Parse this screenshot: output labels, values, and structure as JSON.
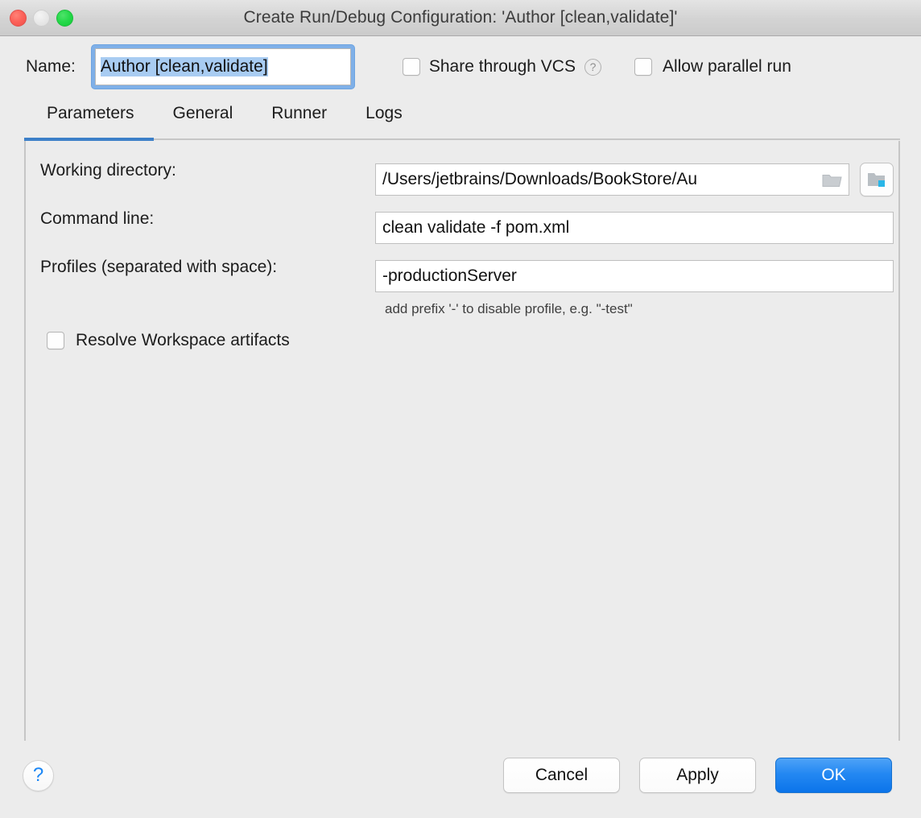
{
  "window": {
    "title": "Create Run/Debug Configuration: 'Author [clean,validate]'",
    "traffic_lights": {
      "close": "close-button",
      "minimize": "minimize-button",
      "maximize": "maximize-button"
    }
  },
  "name_row": {
    "label": "Name:",
    "value": "Author [clean,validate]",
    "placeholder": "",
    "share_vcs": {
      "label": "Share through VCS",
      "checked": false,
      "help_glyph": "?"
    },
    "allow_parallel": {
      "label": "Allow parallel run",
      "checked": false
    }
  },
  "tabs": {
    "active": "Parameters",
    "items": [
      {
        "label": "Parameters"
      },
      {
        "label": "General"
      },
      {
        "label": "Runner"
      },
      {
        "label": "Logs"
      }
    ],
    "accent_color": "#3d80c8"
  },
  "form": {
    "working_directory": {
      "label": "Working directory:",
      "value": "/Users/jetbrains/Downloads/BookStore/Au",
      "browse_icon": "folder-icon",
      "module_icon": "module-folder-icon"
    },
    "command_line": {
      "label": "Command line:",
      "value": "clean validate -f pom.xml"
    },
    "profiles": {
      "label": "Profiles (separated with space):",
      "value": "-productionServer",
      "hint": "add prefix '-' to disable profile, e.g. \"-test\""
    },
    "resolve_workspace_artifacts": {
      "label": "Resolve Workspace artifacts",
      "checked": false
    }
  },
  "bottom_bar": {
    "help_glyph": "?",
    "buttons": [
      {
        "label": "Cancel",
        "kind": "normal"
      },
      {
        "label": "Apply",
        "kind": "normal"
      },
      {
        "label": "OK",
        "kind": "default"
      }
    ]
  },
  "colors": {
    "accent": "#3d80c8",
    "default_button": "#2488f2",
    "help_blue": "#1a86f5",
    "selection": "#a8ccf2",
    "window_bg": "#ececec"
  }
}
